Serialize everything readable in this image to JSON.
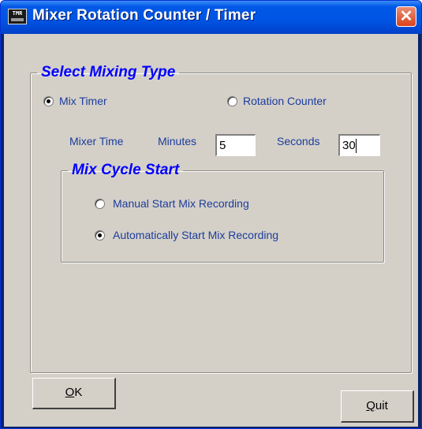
{
  "window": {
    "title": "Mixer Rotation Counter / Timer",
    "icon_text": "TMR",
    "close_glyph": "✕"
  },
  "mixing_type": {
    "legend": "Select Mixing Type",
    "options": [
      {
        "label": "Mix Timer",
        "checked": true
      },
      {
        "label": "Rotation Counter",
        "checked": false
      }
    ],
    "mixer_time_label": "Mixer Time",
    "minutes_label": "Minutes",
    "minutes_value": "5",
    "seconds_label": "Seconds",
    "seconds_value": "30"
  },
  "mix_cycle": {
    "legend": "Mix Cycle Start",
    "options": [
      {
        "label": "Manual Start Mix Recording",
        "checked": false
      },
      {
        "label": "Automatically Start Mix Recording",
        "checked": true
      }
    ]
  },
  "buttons": {
    "ok_mnemonic": "O",
    "ok_rest": "K",
    "quit_mnemonic": "Q",
    "quit_rest": "uit"
  },
  "colors": {
    "titlebar": "#0054e3",
    "dialog_bg": "#d4d0c8",
    "legend": "#0000ff",
    "label": "#1c3c9c",
    "close_button": "#d9431c"
  }
}
